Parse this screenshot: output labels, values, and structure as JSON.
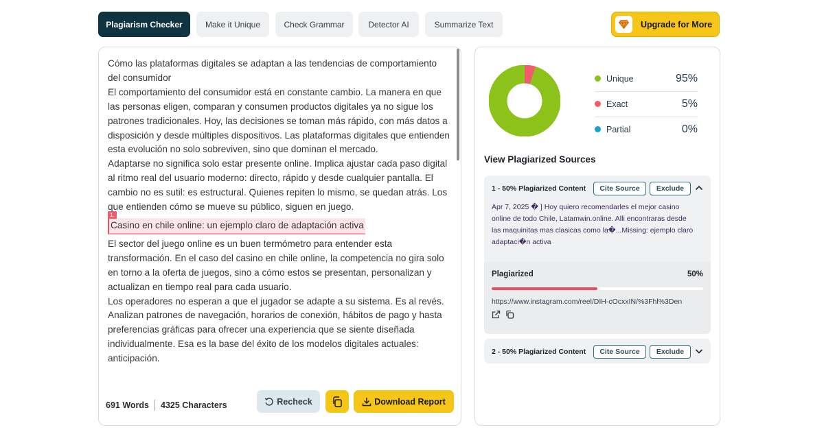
{
  "tabs": [
    {
      "label": "Plagiarism Checker",
      "active": true
    },
    {
      "label": "Make it Unique",
      "active": false
    },
    {
      "label": "Check Grammar",
      "active": false
    },
    {
      "label": "Detector AI",
      "active": false
    },
    {
      "label": "Summarize Text",
      "active": false
    }
  ],
  "upgrade": {
    "label": "Upgrade for More",
    "icon": "diamond-icon"
  },
  "editor": {
    "paragraphs_before": [
      "Cómo las plataformas digitales se adaptan a las tendencias de comportamiento del consumidor",
      "El comportamiento del consumidor está en constante cambio. La manera en que las personas eligen, comparan y consumen productos digitales ya no sigue los patrones tradicionales. Hoy, las decisiones se toman más rápido, con más datos a disposición y desde múltiples dispositivos. Las plataformas digitales que entienden esta evolución no solo sobreviven, sino que dominan el mercado.",
      "Adaptarse no significa solo estar presente online. Implica ajustar cada paso digital al ritmo real del usuario moderno: directo, rápido y desde cualquier pantalla. El cambio no es sutil: es estructural. Quienes repiten lo mismo, se quedan atrás. Los que entienden cómo se mueve su público, siguen en juego."
    ],
    "highlight": {
      "badge": "1.",
      "text": "Casino en chile online: un ejemplo claro de adaptación activa"
    },
    "paragraphs_after": [
      "El sector del juego online es un buen termómetro para entender esta transformación. En el caso del casino en chile online, la competencia no gira solo en torno a la oferta de juegos, sino a cómo estos se presentan, personalizan y actualizan en tiempo real para cada usuario.",
      "Los operadores no esperan a que el jugador se adapte a su sistema. Es al revés. Analizan patrones de navegación, horarios de conexión, hábitos de pago y hasta preferencias gráficas para ofrecer una experiencia que se siente diseñada individualmente. Esa es la base del éxito de los modelos digitales actuales: anticipación."
    ]
  },
  "stats": {
    "words": "691 Words",
    "characters": "4325 Characters"
  },
  "actions": {
    "recheck": "Recheck",
    "download": "Download Report"
  },
  "results": {
    "legend": [
      {
        "label": "Unique",
        "value": "95%",
        "color": "#8cc21a",
        "pct": 95
      },
      {
        "label": "Exact",
        "value": "5%",
        "color": "#ef5c6b",
        "pct": 5
      },
      {
        "label": "Partial",
        "value": "0%",
        "color": "#1aa3c9",
        "pct": 0
      }
    ],
    "sources_title": "View Plagiarized Sources",
    "sources": [
      {
        "title": "1 - 50% Plagiarized Content",
        "cite": "Cite Source",
        "exclude": "Exclude",
        "snippet": "Apr 7, 2025 � ] Hoy quiero recomendarles el mejor casino online de todo Chile, Latamwin.online. Alli encontraras desde las maquinitas mas clasicas como la�...Missing: ejemplo claro adaptaci�n activa",
        "footer_label": "Plagiarized",
        "footer_pct": "50%",
        "fill": 0.5,
        "url": "https://www.instagram.com/reel/DIH-cOcxxIN/%3Fhl%3Den"
      },
      {
        "title": "2 - 50% Plagiarized Content",
        "cite": "Cite Source",
        "exclude": "Exclude"
      }
    ]
  }
}
